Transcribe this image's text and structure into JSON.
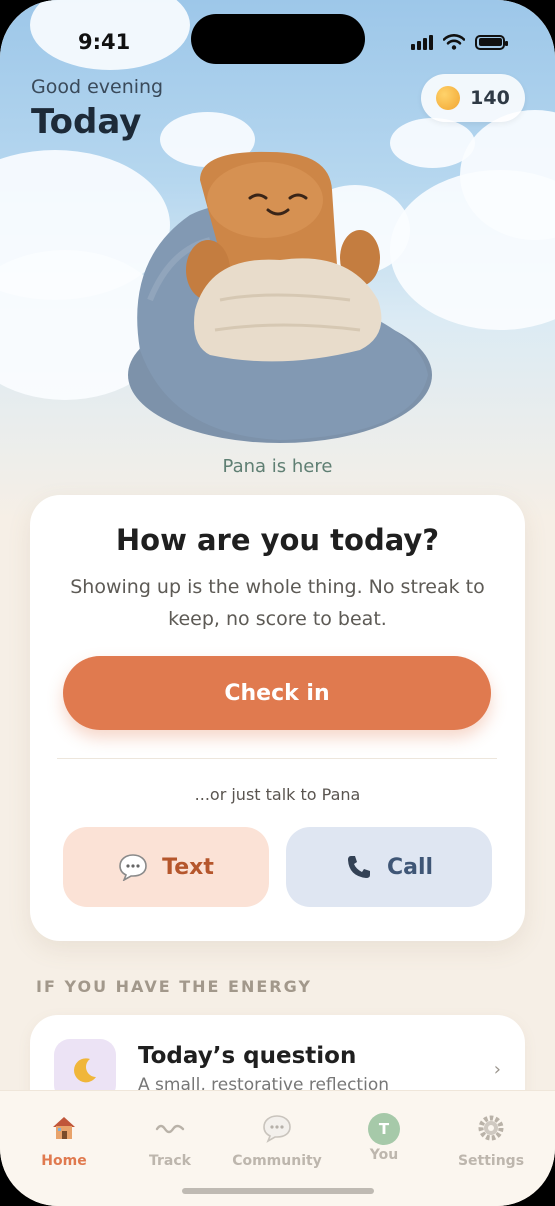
{
  "status": {
    "time": "9:41"
  },
  "header": {
    "greeting": "Good evening",
    "title": "Today",
    "coins": "140"
  },
  "mascot": {
    "caption": "Pana is here"
  },
  "checkin_card": {
    "title": "How are you today?",
    "subtitle": "Showing up is the whole thing. No streak to keep, no score to beat.",
    "primary_label": "Check in",
    "alt_prompt": "...or just talk to Pana",
    "text_label": "Text",
    "call_label": "Call"
  },
  "energy_section": {
    "heading": "IF YOU HAVE THE ENERGY",
    "question_card": {
      "title": "Today’s question",
      "subtitle": "A small, restorative reflection",
      "icon": "moon-icon"
    }
  },
  "tabs": [
    {
      "label": "Home",
      "icon": "house-icon",
      "active": true
    },
    {
      "label": "Track",
      "icon": "wave-icon",
      "active": false
    },
    {
      "label": "Community",
      "icon": "speech-bubble-icon",
      "active": false
    },
    {
      "label": "You",
      "icon": "avatar",
      "avatar_letter": "T",
      "active": false
    },
    {
      "label": "Settings",
      "icon": "gear-icon",
      "active": false
    }
  ],
  "colors": {
    "accent": "#e07a4f",
    "text_button_bg": "#fbe2d6",
    "call_button_bg": "#dfe6f2"
  }
}
